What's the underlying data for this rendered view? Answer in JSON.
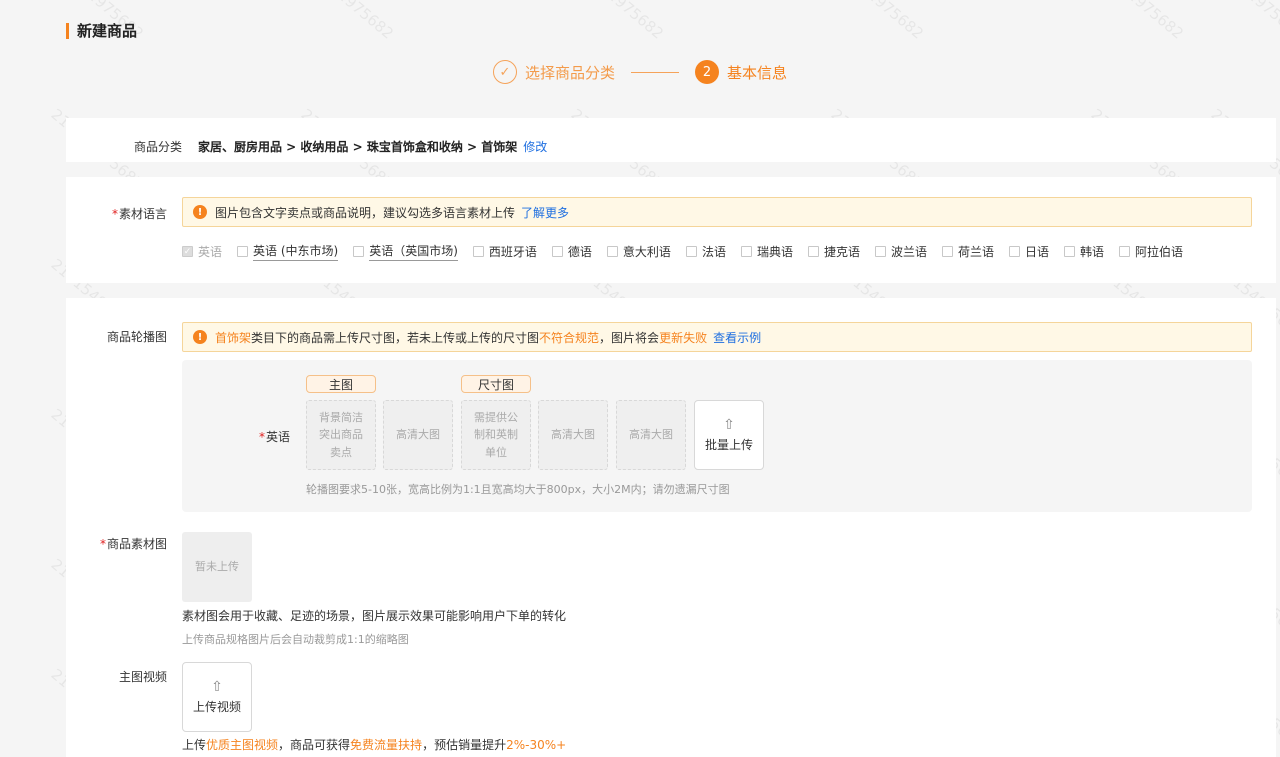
{
  "page": {
    "title": "新建商品"
  },
  "steps": [
    {
      "label": "选择商品分类",
      "marker": "✓"
    },
    {
      "label": "基本信息",
      "marker": "2"
    }
  ],
  "category": {
    "label": "商品分类",
    "path": "家居、厨房用品 > 收纳用品 > 珠宝首饰盒和收纳 > 首饰架",
    "edit_label": "修改"
  },
  "material_language": {
    "label": "素材语言",
    "required_mark": "*",
    "notice": {
      "icon": "warning-icon",
      "text": "图片包含文字卖点或商品说明，建议勾选多语言素材上传",
      "link": "了解更多"
    },
    "languages": [
      {
        "label": "英语",
        "checked": true,
        "disabled": true
      },
      {
        "label": "英语 (中东市场)",
        "checked": false
      },
      {
        "label": "英语（英国市场)",
        "checked": false
      },
      {
        "label": "西班牙语",
        "checked": false
      },
      {
        "label": "德语",
        "checked": false
      },
      {
        "label": "意大利语",
        "checked": false
      },
      {
        "label": "法语",
        "checked": false
      },
      {
        "label": "瑞典语",
        "checked": false
      },
      {
        "label": "捷克语",
        "checked": false
      },
      {
        "label": "波兰语",
        "checked": false
      },
      {
        "label": "荷兰语",
        "checked": false
      },
      {
        "label": "日语",
        "checked": false
      },
      {
        "label": "韩语",
        "checked": false
      },
      {
        "label": "阿拉伯语",
        "checked": false
      }
    ]
  },
  "carousel": {
    "label": "商品轮播图",
    "notice": {
      "icon": "warning-icon",
      "part1": "首饰架",
      "part2": "类目下的商品需上传尺寸图，若未上传或上传的尺寸图",
      "part3": "不符合规范",
      "part4": "，图片将会",
      "part5": "更新失败",
      "link": "查看示例"
    },
    "lang_label": "英语",
    "required_mark": "*",
    "tags": {
      "main": "主图",
      "size": "尺寸图"
    },
    "slots": [
      "背景简洁\n突出商品\n卖点",
      "高清大图",
      "需提供公\n制和英制\n单位",
      "高清大图",
      "高清大图"
    ],
    "bulk_upload": {
      "icon": "upload-icon",
      "label": "批量上传"
    },
    "hint": "轮播图要求5-10张，宽高比例为1:1且宽高均大于800px，大小2M内；请勿遗漏尺寸图"
  },
  "material_image": {
    "label": "商品素材图",
    "required_mark": "*",
    "placeholder": "暂未上传",
    "desc": "素材图会用于收藏、足迹的场景，图片展示效果可能影响用户下单的转化",
    "hint": "上传商品规格图片后会自动裁剪成1:1的缩略图"
  },
  "video": {
    "label": "主图视频",
    "upload": {
      "icon": "upload-icon",
      "label": "上传视频"
    },
    "desc": {
      "p1": "上传",
      "p2": "优质主图视频",
      "p3": "，商品可获得",
      "p4": "免费流量扶持",
      "p5": "，预估销量提升",
      "p6": "2%-30%+"
    }
  },
  "watermark_text": "216154975682",
  "colors": {
    "accent": "#f5831f",
    "link": "#1f6fe0",
    "notice_bg": "#fff8e6"
  }
}
